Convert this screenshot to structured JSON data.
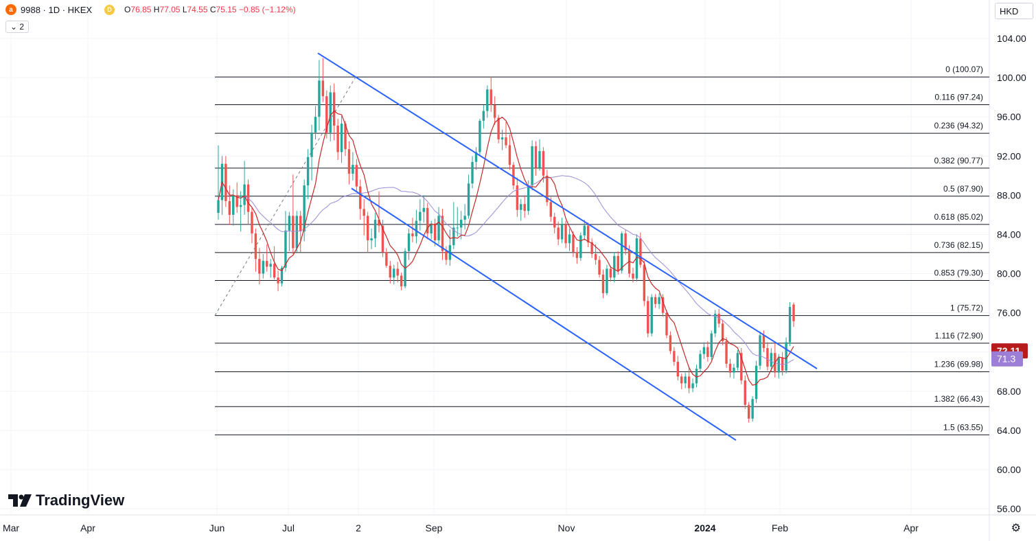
{
  "header": {
    "symbol_icon": "alibaba-logo-icon",
    "symbol": "9988 · 1D · HKEX",
    "badge": "D",
    "ohlc": [
      {
        "k": "O",
        "v": "76.85"
      },
      {
        "k": "H",
        "v": "77.05"
      },
      {
        "k": "L",
        "v": "74.55"
      },
      {
        "k": "C",
        "v": "75.15"
      }
    ],
    "change": "−0.85 (−1.12%)",
    "indicator_toggle": "⌄ 2"
  },
  "currency": "HKD",
  "brand": "TradingView",
  "colors": {
    "up": "#26a69a",
    "down": "#ef5350",
    "ma_fast": "#c62828",
    "ma_slow": "#9c8ad6",
    "channel": "#2962ff",
    "fib": "#131722",
    "last_price_bg": "#b71c1c",
    "ma_label_bg": "#9c7ed6"
  },
  "chart_data": {
    "type": "candlestick",
    "y_axis": {
      "range": [
        55,
        105
      ],
      "ticks": [
        "104.00",
        "100.00",
        "96.00",
        "92.00",
        "88.00",
        "84.00",
        "80.00",
        "76.00",
        "72.00",
        "68.00",
        "64.00",
        "60.00",
        "56.00"
      ]
    },
    "x_axis": {
      "labels": [
        "Mar",
        "Apr",
        "Jun",
        "Jul",
        "2",
        "Sep",
        "Nov",
        "2024",
        "Feb",
        "Apr"
      ]
    },
    "fib_levels": [
      {
        "label": "0 (100.07)",
        "value": 100.07
      },
      {
        "label": "0.116 (97.24)",
        "value": 97.24
      },
      {
        "label": "0.236 (94.32)",
        "value": 94.32
      },
      {
        "label": "0.382 (90.77)",
        "value": 90.77
      },
      {
        "label": "0.5 (87.90)",
        "value": 87.9
      },
      {
        "label": "0.618 (85.02)",
        "value": 85.02
      },
      {
        "label": "0.736 (82.15)",
        "value": 82.15
      },
      {
        "label": "0.853 (79.30)",
        "value": 79.3
      },
      {
        "label": "1 (75.72)",
        "value": 75.72
      },
      {
        "label": "1.116 (72.90)",
        "value": 72.9
      },
      {
        "label": "1.236 (69.98)",
        "value": 69.98
      },
      {
        "label": "1.382 (66.43)",
        "value": 66.43
      },
      {
        "label": "1.5 (63.55)",
        "value": 63.55
      }
    ],
    "fib_trend_line": {
      "from": {
        "x": "Jun",
        "y": 75.72
      },
      "to": {
        "x": "2",
        "y": 100.07
      }
    },
    "channel_lines": [
      {
        "name": "upper",
        "from": {
          "x": "Jul",
          "y": 102.5
        },
        "to": {
          "x": "Feb",
          "y": 71.1
        }
      },
      {
        "name": "lower",
        "from": {
          "x": "Jul",
          "y": 88.6
        },
        "to": {
          "x": "2024",
          "y": 63.0
        }
      }
    ],
    "last_price": {
      "label": "72.11",
      "value": 72.11
    },
    "ma_value": {
      "label": "71.3",
      "value": 71.3
    },
    "candles": [
      [
        86.2,
        93.1,
        85.5,
        87.5
      ],
      [
        87.5,
        92.0,
        86.0,
        91.2
      ],
      [
        91.2,
        92.0,
        86.8,
        87.4
      ],
      [
        87.4,
        89.0,
        85.0,
        86.0
      ],
      [
        86.0,
        88.6,
        84.9,
        88.0
      ],
      [
        88.0,
        89.3,
        86.2,
        86.8
      ],
      [
        86.8,
        88.4,
        84.3,
        87.0
      ],
      [
        87.0,
        91.5,
        86.0,
        89.1
      ],
      [
        89.1,
        89.6,
        85.0,
        86.3
      ],
      [
        86.3,
        86.8,
        83.1,
        84.1
      ],
      [
        84.1,
        84.6,
        80.2,
        81.5
      ],
      [
        81.5,
        82.6,
        78.9,
        80.0
      ],
      [
        80.0,
        82.0,
        79.5,
        81.3
      ],
      [
        81.3,
        83.0,
        80.2,
        80.7
      ],
      [
        80.7,
        81.5,
        79.6,
        81.0
      ],
      [
        81.0,
        82.8,
        79.4,
        79.6
      ],
      [
        79.6,
        80.3,
        78.2,
        79.0
      ],
      [
        79.0,
        80.8,
        78.7,
        80.6
      ],
      [
        80.6,
        86.4,
        80.2,
        84.4
      ],
      [
        84.4,
        86.3,
        82.3,
        85.9
      ],
      [
        85.9,
        90.1,
        82.0,
        82.6
      ],
      [
        82.6,
        86.4,
        82.2,
        85.9
      ],
      [
        85.9,
        86.4,
        82.2,
        84.3
      ],
      [
        84.3,
        89.6,
        83.3,
        89.0
      ],
      [
        89.0,
        92.7,
        87.6,
        91.9
      ],
      [
        91.9,
        95.2,
        89.5,
        94.4
      ],
      [
        94.4,
        97.1,
        93.7,
        96.0
      ],
      [
        96.0,
        101.8,
        94.6,
        99.7
      ],
      [
        99.7,
        102.0,
        97.5,
        98.1
      ],
      [
        98.1,
        98.7,
        93.8,
        94.4
      ],
      [
        94.4,
        99.2,
        93.5,
        98.5
      ],
      [
        98.5,
        99.4,
        93.6,
        95.1
      ],
      [
        95.1,
        95.8,
        91.6,
        92.4
      ],
      [
        92.4,
        96.1,
        91.3,
        95.3
      ],
      [
        95.3,
        95.6,
        92.0,
        92.7
      ],
      [
        92.7,
        93.5,
        89.1,
        90.2
      ],
      [
        90.2,
        92.4,
        89.5,
        91.1
      ],
      [
        91.1,
        91.7,
        88.3,
        88.9
      ],
      [
        88.9,
        89.6,
        85.5,
        86.6
      ],
      [
        86.6,
        87.6,
        83.9,
        85.9
      ],
      [
        85.9,
        86.3,
        82.1,
        83.4
      ],
      [
        83.4,
        84.6,
        82.5,
        83.6
      ],
      [
        83.6,
        86.2,
        82.7,
        85.5
      ],
      [
        85.5,
        88.4,
        84.2,
        84.9
      ],
      [
        84.9,
        85.5,
        81.7,
        82.2
      ],
      [
        82.2,
        82.6,
        80.6,
        80.8
      ],
      [
        80.8,
        81.3,
        79.0,
        79.6
      ],
      [
        79.6,
        80.9,
        78.9,
        80.5
      ],
      [
        80.5,
        81.2,
        79.1,
        79.8
      ],
      [
        79.8,
        80.1,
        78.3,
        78.7
      ],
      [
        78.7,
        82.6,
        78.5,
        82.3
      ],
      [
        82.3,
        84.6,
        81.4,
        84.1
      ],
      [
        84.1,
        85.7,
        83.2,
        83.8
      ],
      [
        83.8,
        86.5,
        83.1,
        85.4
      ],
      [
        85.4,
        87.6,
        84.4,
        86.3
      ],
      [
        86.3,
        88.0,
        85.2,
        86.7
      ],
      [
        86.7,
        87.2,
        83.5,
        84.1
      ],
      [
        84.1,
        85.4,
        83.5,
        85.1
      ],
      [
        85.1,
        85.6,
        82.8,
        83.4
      ],
      [
        83.4,
        86.8,
        83.0,
        85.9
      ],
      [
        85.9,
        86.6,
        81.4,
        82.3
      ],
      [
        82.3,
        82.8,
        80.9,
        81.4
      ],
      [
        81.4,
        84.5,
        80.8,
        82.9
      ],
      [
        82.9,
        87.3,
        82.5,
        84.7
      ],
      [
        84.7,
        86.8,
        83.8,
        84.7
      ],
      [
        84.7,
        86.4,
        83.5,
        85.5
      ],
      [
        85.5,
        87.1,
        84.5,
        85.9
      ],
      [
        85.9,
        90.1,
        85.6,
        89.2
      ],
      [
        89.2,
        92.0,
        88.7,
        91.4
      ],
      [
        91.4,
        92.9,
        90.6,
        92.4
      ],
      [
        92.4,
        95.8,
        92.1,
        95.6
      ],
      [
        95.6,
        97.2,
        94.8,
        96.6
      ],
      [
        96.6,
        99.2,
        95.9,
        98.8
      ],
      [
        98.8,
        100.1,
        96.5,
        97.2
      ],
      [
        97.2,
        98.1,
        95.2,
        95.9
      ],
      [
        95.9,
        96.2,
        93.3,
        93.7
      ],
      [
        93.7,
        94.7,
        92.6,
        93.9
      ],
      [
        93.9,
        95.5,
        92.8,
        93.1
      ],
      [
        93.1,
        94.2,
        90.6,
        91.1
      ],
      [
        91.1,
        91.4,
        88.6,
        89.0
      ],
      [
        89.0,
        89.8,
        85.8,
        86.5
      ],
      [
        86.5,
        87.6,
        85.4,
        87.1
      ],
      [
        87.1,
        88.0,
        85.7,
        86.4
      ],
      [
        86.4,
        89.5,
        86.0,
        89.0
      ],
      [
        89.0,
        93.6,
        88.5,
        93.0
      ],
      [
        93.0,
        93.5,
        90.0,
        90.8
      ],
      [
        90.8,
        93.7,
        90.5,
        92.5
      ],
      [
        92.5,
        92.9,
        89.3,
        90.0
      ],
      [
        90.0,
        90.6,
        86.9,
        87.3
      ],
      [
        87.3,
        87.8,
        85.3,
        85.8
      ],
      [
        85.8,
        86.2,
        84.1,
        84.7
      ],
      [
        84.7,
        85.3,
        82.9,
        83.5
      ],
      [
        83.5,
        85.7,
        83.1,
        85.0
      ],
      [
        85.0,
        85.4,
        82.6,
        83.1
      ],
      [
        83.1,
        84.6,
        82.3,
        84.0
      ],
      [
        84.0,
        84.3,
        81.7,
        82.2
      ],
      [
        82.2,
        82.7,
        81.0,
        81.6
      ],
      [
        81.6,
        84.2,
        81.3,
        83.9
      ],
      [
        83.9,
        85.5,
        83.4,
        84.9
      ],
      [
        84.9,
        85.2,
        82.7,
        83.2
      ],
      [
        83.2,
        83.6,
        81.6,
        82.0
      ],
      [
        82.0,
        83.0,
        80.9,
        81.4
      ],
      [
        81.4,
        81.8,
        79.6,
        79.9
      ],
      [
        79.9,
        80.4,
        77.5,
        78.0
      ],
      [
        78.0,
        80.9,
        77.8,
        80.5
      ],
      [
        80.5,
        80.8,
        79.2,
        79.6
      ],
      [
        79.6,
        82.2,
        79.1,
        81.8
      ],
      [
        81.8,
        82.3,
        79.9,
        80.3
      ],
      [
        80.3,
        84.3,
        80.0,
        84.1
      ],
      [
        84.1,
        84.5,
        81.9,
        82.4
      ],
      [
        82.4,
        82.9,
        79.6,
        80.0
      ],
      [
        80.0,
        80.6,
        79.1,
        79.5
      ],
      [
        79.5,
        84.0,
        79.2,
        83.6
      ],
      [
        83.6,
        84.2,
        80.6,
        80.9
      ],
      [
        80.9,
        81.3,
        76.7,
        77.2
      ],
      [
        77.2,
        77.7,
        73.5,
        73.9
      ],
      [
        73.9,
        77.9,
        73.6,
        77.6
      ],
      [
        77.6,
        77.9,
        76.5,
        76.9
      ],
      [
        76.9,
        78.0,
        76.4,
        77.6
      ],
      [
        77.6,
        77.9,
        75.6,
        76.0
      ],
      [
        76.0,
        76.3,
        73.4,
        73.7
      ],
      [
        73.7,
        74.1,
        71.8,
        72.1
      ],
      [
        72.1,
        72.5,
        70.6,
        71.0
      ],
      [
        71.0,
        71.6,
        69.1,
        69.5
      ],
      [
        69.5,
        69.8,
        68.2,
        68.8
      ],
      [
        68.8,
        69.9,
        68.3,
        69.5
      ],
      [
        69.5,
        70.5,
        67.8,
        68.3
      ],
      [
        68.3,
        69.3,
        67.9,
        68.8
      ],
      [
        68.8,
        70.7,
        68.4,
        70.3
      ],
      [
        70.3,
        72.2,
        70.0,
        71.8
      ],
      [
        71.8,
        73.0,
        71.3,
        72.5
      ],
      [
        72.5,
        73.1,
        71.0,
        71.5
      ],
      [
        71.5,
        74.2,
        71.2,
        73.9
      ],
      [
        73.9,
        76.3,
        73.5,
        75.9
      ],
      [
        75.9,
        76.4,
        74.5,
        74.9
      ],
      [
        74.9,
        75.3,
        72.7,
        73.1
      ],
      [
        73.1,
        73.5,
        70.4,
        70.8
      ],
      [
        70.8,
        71.3,
        69.4,
        69.9
      ],
      [
        69.9,
        70.8,
        69.3,
        70.4
      ],
      [
        70.4,
        72.2,
        70.1,
        71.9
      ],
      [
        71.9,
        72.4,
        68.7,
        69.1
      ],
      [
        69.1,
        69.6,
        66.2,
        66.6
      ],
      [
        66.6,
        66.9,
        64.8,
        65.2
      ],
      [
        65.2,
        67.5,
        64.9,
        67.2
      ],
      [
        67.2,
        71.1,
        66.8,
        70.6
      ],
      [
        70.6,
        74.1,
        70.2,
        73.7
      ],
      [
        73.7,
        74.2,
        72.0,
        72.4
      ],
      [
        72.4,
        73.0,
        70.1,
        70.5
      ],
      [
        70.5,
        72.4,
        70.0,
        71.9
      ],
      [
        71.9,
        73.1,
        69.4,
        69.9
      ],
      [
        69.9,
        71.8,
        69.3,
        71.4
      ],
      [
        71.4,
        72.0,
        69.6,
        70.1
      ],
      [
        70.1,
        73.5,
        69.8,
        73.0
      ],
      [
        73.0,
        77.1,
        72.6,
        76.6
      ],
      [
        76.85,
        77.05,
        74.55,
        75.15
      ]
    ]
  }
}
